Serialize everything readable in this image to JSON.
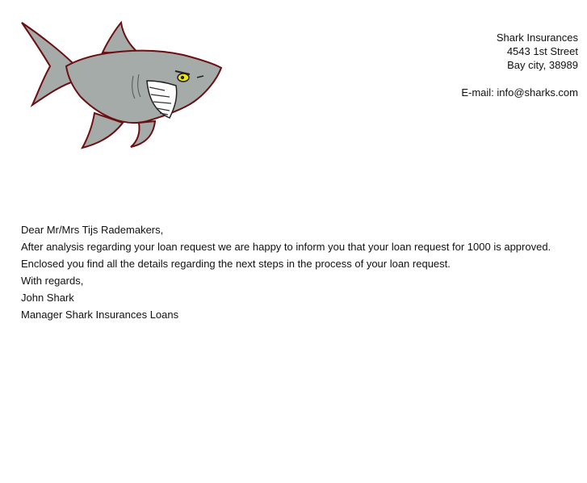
{
  "sender": {
    "company": "Shark Insurances",
    "street": "4543 1st Street",
    "city": "Bay city, 38989",
    "email": "E-mail: info@sharks.com"
  },
  "letter": {
    "salutation": "Dear Mr/Mrs Tijs Rademakers,",
    "body": "After analysis regarding your loan request we are happy to inform you that your loan request for 1000 is approved. Enclosed you find all the details regarding the next steps in the process of your loan request.",
    "closing": "With regards,",
    "signature_name": "John Shark",
    "signature_title": "Manager Shark Insurances Loans"
  },
  "colors": {
    "shark_body": "#a4aba8",
    "shark_outline": "#6b0f12",
    "eye": "#f2e60c"
  }
}
